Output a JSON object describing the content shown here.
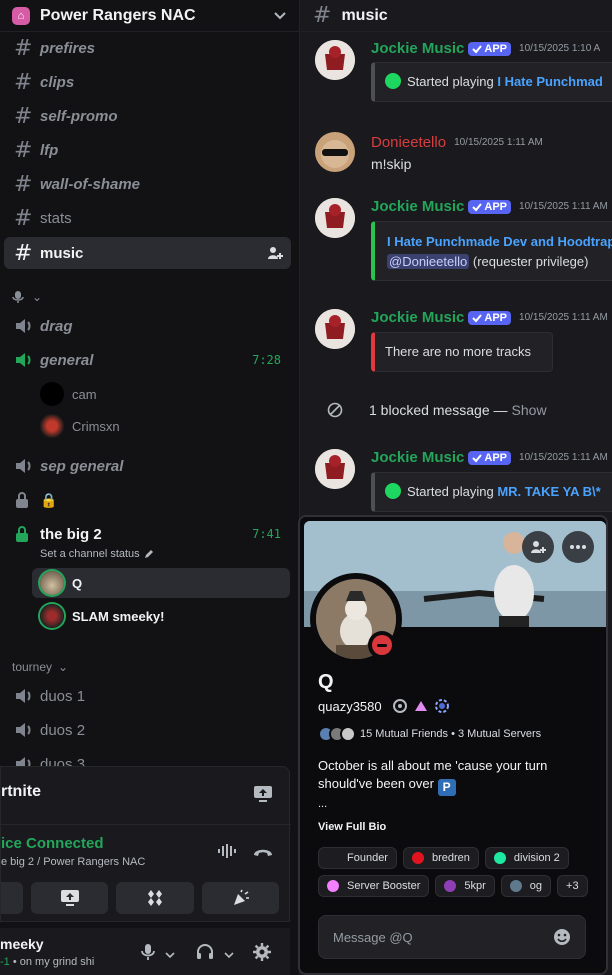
{
  "server": {
    "name": "Power Rangers NAC"
  },
  "sidebar": {
    "channels": [
      {
        "label": "prefires"
      },
      {
        "label": "clips"
      },
      {
        "label": "self-promo"
      },
      {
        "label": "lfp"
      },
      {
        "label": "wall-of-shame"
      },
      {
        "label": "stats"
      },
      {
        "label": "music"
      }
    ],
    "voice": [
      {
        "label": "drag"
      },
      {
        "label": "general",
        "timer": "7:28",
        "users": [
          "cam",
          "Crimsxn"
        ]
      },
      {
        "label": "sep general"
      },
      {
        "label": "🔒"
      },
      {
        "label": "the big 2",
        "timer": "7:41",
        "status_hint": "Set a channel status",
        "users": [
          "Q",
          "SLAM smeeky!"
        ]
      }
    ],
    "category_tourney": "tourney",
    "tourney_channels": [
      "duos 1",
      "duos 2",
      "duos 3"
    ]
  },
  "voice_panel": {
    "activity": "rtnite",
    "status": "ice Connected",
    "sub": "e big 2 / Power Rangers NAC"
  },
  "user_panel": {
    "name": "meeky",
    "status": "• on my grind shi",
    "status_prefix": "-1"
  },
  "chat": {
    "channel": "music",
    "messages": [
      {
        "author": "Jockie Music",
        "badge": "APP",
        "time": "10/15/2025 1:10 A",
        "embed_prefix": "Started playing ",
        "embed_link": "I Hate Punchmad"
      },
      {
        "author": "Donieetello",
        "time": "10/15/2025 1:11 AM",
        "text": "m!skip"
      },
      {
        "author": "Jockie Music",
        "badge": "APP",
        "time": "10/15/2025 1:11 AM",
        "embed_link": "I Hate Punchmade Dev and Hoodtrap",
        "mention": "@Donieetello",
        "embed_suffix": " (requester privilege)"
      },
      {
        "author": "Jockie Music",
        "badge": "APP",
        "time": "10/15/2025 1:11 AM",
        "embed_text": "There are no more tracks"
      },
      {
        "author": "Jockie Music",
        "badge": "APP",
        "time": "10/15/2025 1:11 AM",
        "embed_prefix": "Started playing ",
        "embed_link": "MR. TAKE YA B\\*"
      }
    ],
    "blocked": {
      "text": "1 blocked message — ",
      "show": "Show"
    }
  },
  "profile": {
    "display_name": "Q",
    "username": "quazy3580",
    "mutual": "15 Mutual Friends • 3 Mutual Servers",
    "bio_line1": "October is all about me 'cause your turn",
    "bio_line2": "should've been over",
    "bio_badge": "P",
    "bio_more": "...",
    "view_full_bio": "View Full Bio",
    "roles": [
      {
        "name": "Founder",
        "color": ""
      },
      {
        "name": "bredren",
        "color": "#e0141e"
      },
      {
        "name": "division 2",
        "color": "#1de9a0"
      },
      {
        "name": "Server Booster",
        "color": "#f47fff"
      },
      {
        "name": "5kpr",
        "color": "#8e3fb5"
      },
      {
        "name": "og",
        "color": "#5f7a8c"
      },
      {
        "name": "+3",
        "color": ""
      }
    ],
    "message_placeholder": "Message @Q"
  },
  "colors": {
    "accent_green": "#23a55a",
    "brand": "#5865f2",
    "dnd": "#da373c"
  }
}
